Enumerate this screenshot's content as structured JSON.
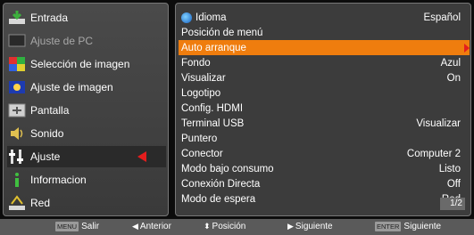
{
  "left_menu": {
    "items": [
      {
        "label": "Entrada",
        "icon": "input-icon"
      },
      {
        "label": "Ajuste de PC",
        "icon": "pc-adjust-icon"
      },
      {
        "label": "Selección de imagen",
        "icon": "image-select-icon"
      },
      {
        "label": "Ajuste de imagen",
        "icon": "image-adjust-icon"
      },
      {
        "label": "Pantalla",
        "icon": "screen-icon"
      },
      {
        "label": "Sonido",
        "icon": "sound-icon"
      },
      {
        "label": "Ajuste",
        "icon": "setting-icon"
      },
      {
        "label": "Informacion",
        "icon": "info-icon"
      },
      {
        "label": "Red",
        "icon": "network-icon"
      }
    ],
    "selected_index": 6
  },
  "settings": {
    "items": [
      {
        "label": "Idioma",
        "value": "Español"
      },
      {
        "label": "Posición de menú",
        "value": ""
      },
      {
        "label": "Auto arranque",
        "value": ""
      },
      {
        "label": "Fondo",
        "value": "Azul"
      },
      {
        "label": "Visualizar",
        "value": "On"
      },
      {
        "label": "Logotipo",
        "value": ""
      },
      {
        "label": "Config. HDMI",
        "value": ""
      },
      {
        "label": "Terminal USB",
        "value": "Visualizar"
      },
      {
        "label": "Puntero",
        "value": ""
      },
      {
        "label": "Conector",
        "value": "Computer 2"
      },
      {
        "label": "Modo bajo consumo",
        "value": "Listo"
      },
      {
        "label": "Conexión Directa",
        "value": "Off"
      },
      {
        "label": "Modo de espera",
        "value": "Red"
      }
    ],
    "highlight_index": 2,
    "page": "1/2"
  },
  "bottom_bar": {
    "exit_key": "MENU",
    "exit_label": "Salir",
    "prev_label": "Anterior",
    "pos_label": "Posición",
    "next_label": "Siguiente",
    "enter_key": "ENTER",
    "enter_label": "Siguiente"
  },
  "colors": {
    "highlight": "#ef7d0e",
    "arrow": "#e41d1d"
  }
}
